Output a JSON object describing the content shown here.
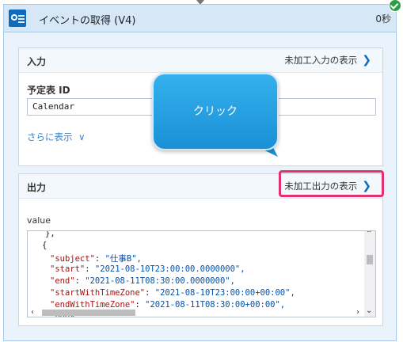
{
  "card": {
    "title": "イベントの取得 (V4)",
    "duration": "0秒",
    "status": "succeeded"
  },
  "input_section": {
    "title": "入力",
    "raw_link": "未加工入力の表示",
    "field_label": "予定表 ID",
    "field_value": "Calendar",
    "more_link": "さらに表示"
  },
  "output_section": {
    "title": "出力",
    "raw_link": "未加工出力の表示",
    "value_label": "value",
    "code": {
      "l1": "},",
      "l2": "{",
      "l3k": "\"subject\"",
      "l3v": "\"仕事B\",",
      "l4k": "\"start\"",
      "l4v": "\"2021-08-10T23:00:00.0000000\",",
      "l5k": "\"end\"",
      "l5v": "\"2021-08-11T08:30:00.0000000\",",
      "l6k": "\"startWithTimeZone\"",
      "l6v": "\"2021-08-10T23:00:00+00:00\",",
      "l7k": "\"endWithTimeZone\"",
      "l7v": "\"2021-08-11T08:30:00+00:00\",",
      "l8k": "\"body\"",
      "l8v": "\"\","
    }
  },
  "callout": {
    "text": "クリック"
  },
  "colors": {
    "accent": "#0f6cbd",
    "highlight": "#e5306e",
    "callout": "#1a90d6",
    "success": "#2e9e44"
  }
}
